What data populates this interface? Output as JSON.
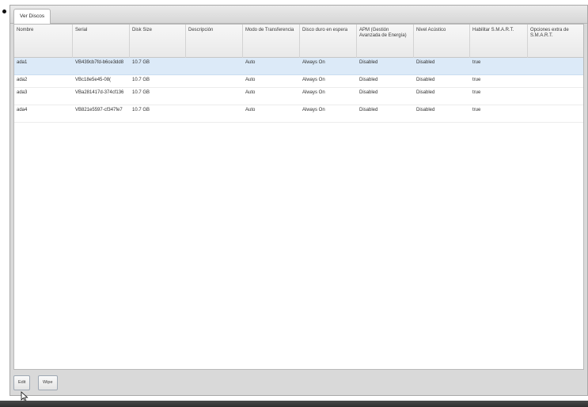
{
  "tabs": [
    {
      "label": "Ver Discos",
      "active": true
    }
  ],
  "table": {
    "columns": [
      "Nombre",
      "Serial",
      "Disk Size",
      "Descripción",
      "Modo de Transferencia",
      "Disco duro en espera",
      "APM (Gestión Avanzada de Energía)",
      "Nivel Acústico",
      "Habilitar S.M.A.R.T.",
      "Opciones extra de S.M.A.R.T."
    ],
    "rows": [
      {
        "selected": true,
        "cells": [
          "ada1",
          "VB439cb7fd-b6ce3dd8",
          "10.7 GB",
          "",
          "Auto",
          "Always On",
          "Disabled",
          "Disabled",
          "true",
          ""
        ]
      },
      {
        "selected": false,
        "cells": [
          "ada2",
          "VBc18e5e45-08(",
          "10.7 GB",
          "",
          "Auto",
          "Always On",
          "Disabled",
          "Disabled",
          "true",
          ""
        ]
      },
      {
        "selected": false,
        "cells": [
          "ada3",
          "VBa281417d-374cf136",
          "10.7 GB",
          "",
          "Auto",
          "Always On",
          "Disabled",
          "Disabled",
          "true",
          ""
        ]
      },
      {
        "selected": false,
        "cells": [
          "ada4",
          "VB821e5597-cf347fe7",
          "10.7 GB",
          "",
          "Auto",
          "Always On",
          "Disabled",
          "Disabled",
          "true",
          ""
        ]
      }
    ]
  },
  "buttons": {
    "edit_label": "Edit",
    "wipe_label": "Wipe"
  },
  "colors": {
    "selected_row": "#dceaf8",
    "frame": "#d9d9d9"
  },
  "icons": [
    "mouse-cursor-icon"
  ]
}
